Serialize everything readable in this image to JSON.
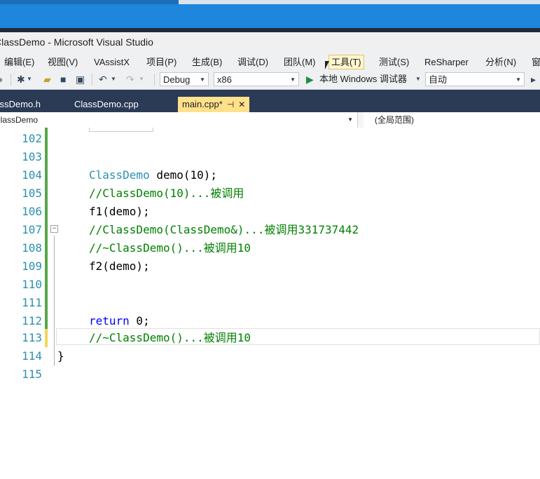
{
  "window": {
    "title": "ClassDemo - Microsoft Visual Studio"
  },
  "menu": [
    {
      "label": "编辑(E)"
    },
    {
      "label": "视图(V)"
    },
    {
      "label": "VAssistX"
    },
    {
      "label": "项目(P)"
    },
    {
      "label": "生成(B)"
    },
    {
      "label": "调试(D)"
    },
    {
      "label": "团队(M)"
    },
    {
      "label": "工具(T)"
    },
    {
      "label": "测试(S)"
    },
    {
      "label": "ReSharper"
    },
    {
      "label": "分析(N)"
    },
    {
      "label": "窗"
    }
  ],
  "toolbar": {
    "config": "Debug",
    "platform": "x86",
    "debugger": "本地 Windows 调试器",
    "mode": "自动"
  },
  "tabs": [
    {
      "label": "ClassDemo.h"
    },
    {
      "label": "ClassDemo.cpp"
    },
    {
      "label": "main.cpp*",
      "pin": "⊣",
      "close": "✕"
    }
  ],
  "navbar": {
    "scope": "ClassDemo",
    "context": "(全局范围)"
  },
  "code_lines": [
    {
      "num": "102",
      "text": ""
    },
    {
      "num": "103",
      "text": ""
    },
    {
      "num": "104",
      "type": "ClassDemo",
      "rest": " demo(10);"
    },
    {
      "num": "105",
      "comment": "//ClassDemo(10)...被调用"
    },
    {
      "num": "106",
      "text": "f1(demo);"
    },
    {
      "num": "107",
      "comment": "//ClassDemo(ClassDemo&)...被调用331737442"
    },
    {
      "num": "108",
      "comment": "//~ClassDemo()...被调用10"
    },
    {
      "num": "109",
      "text": "f2(demo);"
    },
    {
      "num": "110",
      "text": ""
    },
    {
      "num": "111",
      "text": ""
    },
    {
      "num": "112",
      "keyword": "return",
      "rest": " 0;"
    },
    {
      "num": "113",
      "comment": "//~ClassDemo()...被调用10"
    },
    {
      "num": "114",
      "text": "}"
    },
    {
      "num": "115",
      "text": ""
    }
  ]
}
